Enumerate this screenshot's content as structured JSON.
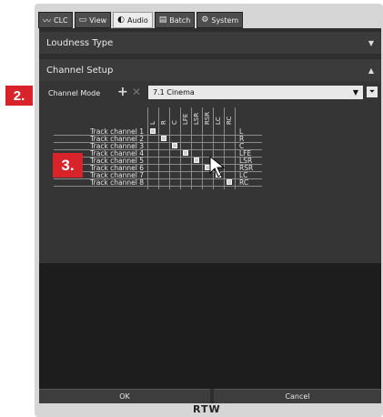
{
  "tabs": [
    {
      "label": "CLC",
      "icon": "waveform-icon",
      "active": false
    },
    {
      "label": "View",
      "icon": "monitor-icon",
      "active": false
    },
    {
      "label": "Audio",
      "icon": "audio-wave-icon",
      "active": true
    },
    {
      "label": "Batch",
      "icon": "batch-icon",
      "active": false
    },
    {
      "label": "System",
      "icon": "gear-icon",
      "active": false
    }
  ],
  "loudness": {
    "title": "Loudness Type"
  },
  "channel_setup": {
    "title": "Channel Setup",
    "mode_label": "Channel Mode",
    "mode_value": "7.1 Cinema",
    "columns": [
      "L",
      "R",
      "C",
      "LFE",
      "LSR",
      "RSR",
      "LC",
      "RC"
    ],
    "rows": [
      {
        "label": "Track channel 1",
        "output": "L"
      },
      {
        "label": "Track channel 2",
        "output": "R"
      },
      {
        "label": "Track channel 3",
        "output": "C"
      },
      {
        "label": "Track channel 4",
        "output": "LFE"
      },
      {
        "label": "Track channel 5",
        "output": "LSR"
      },
      {
        "label": "Track channel 6",
        "output": "RSR"
      },
      {
        "label": "Track channel 7",
        "output": "LC"
      },
      {
        "label": "Track channel 8",
        "output": "RC"
      }
    ],
    "active_cells": [
      0,
      1,
      2,
      3,
      4,
      5,
      6,
      7
    ]
  },
  "buttons": {
    "ok": "OK",
    "cancel": "Cancel"
  },
  "brand": "RTW",
  "callouts": {
    "two": "2.",
    "three": "3."
  },
  "colors": {
    "accent": "#d8232a",
    "panel": "#2e2e2e"
  }
}
